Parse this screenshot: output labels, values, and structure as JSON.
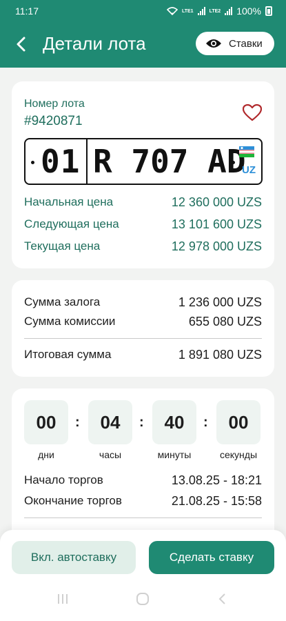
{
  "status": {
    "time": "11:17",
    "battery": "100%",
    "sim1": "LTE1",
    "sim2": "LTE2"
  },
  "header": {
    "title": "Детали лота",
    "bids_label": "Ставки"
  },
  "lot": {
    "label": "Номер лота",
    "number": "#9420871",
    "plate": {
      "region": "01",
      "number": "R 707 AD",
      "country": "UZ"
    },
    "prices": [
      {
        "label": "Начальная цена",
        "value": "12 360 000 UZS"
      },
      {
        "label": "Следующая цена",
        "value": "13 101 600 UZS"
      },
      {
        "label": "Текущая цена",
        "value": "12 978 000 UZS"
      }
    ]
  },
  "payment": {
    "deposit_label": "Сумма залога",
    "deposit_value": "1 236 000 UZS",
    "commission_label": "Сумма комиссии",
    "commission_value": "655 080 UZS",
    "total_label": "Итоговая сумма",
    "total_value": "1 891 080 UZS"
  },
  "timer": {
    "days": "00",
    "hours": "04",
    "minutes": "40",
    "seconds": "00",
    "days_label": "дни",
    "hours_label": "часы",
    "minutes_label": "минуты",
    "seconds_label": "секунды",
    "start_label": "Начало торгов",
    "start_value": "13.08.25 - 18:21",
    "end_label": "Окончание торгов",
    "end_value": "21.08.25 - 15:58"
  },
  "actions": {
    "auto_bid": "Вкл. автоставку",
    "make_bid": "Сделать ставку"
  },
  "colors": {
    "primary": "#1f8a73",
    "text_green": "#1f6e5d",
    "heart": "#b0282b"
  }
}
